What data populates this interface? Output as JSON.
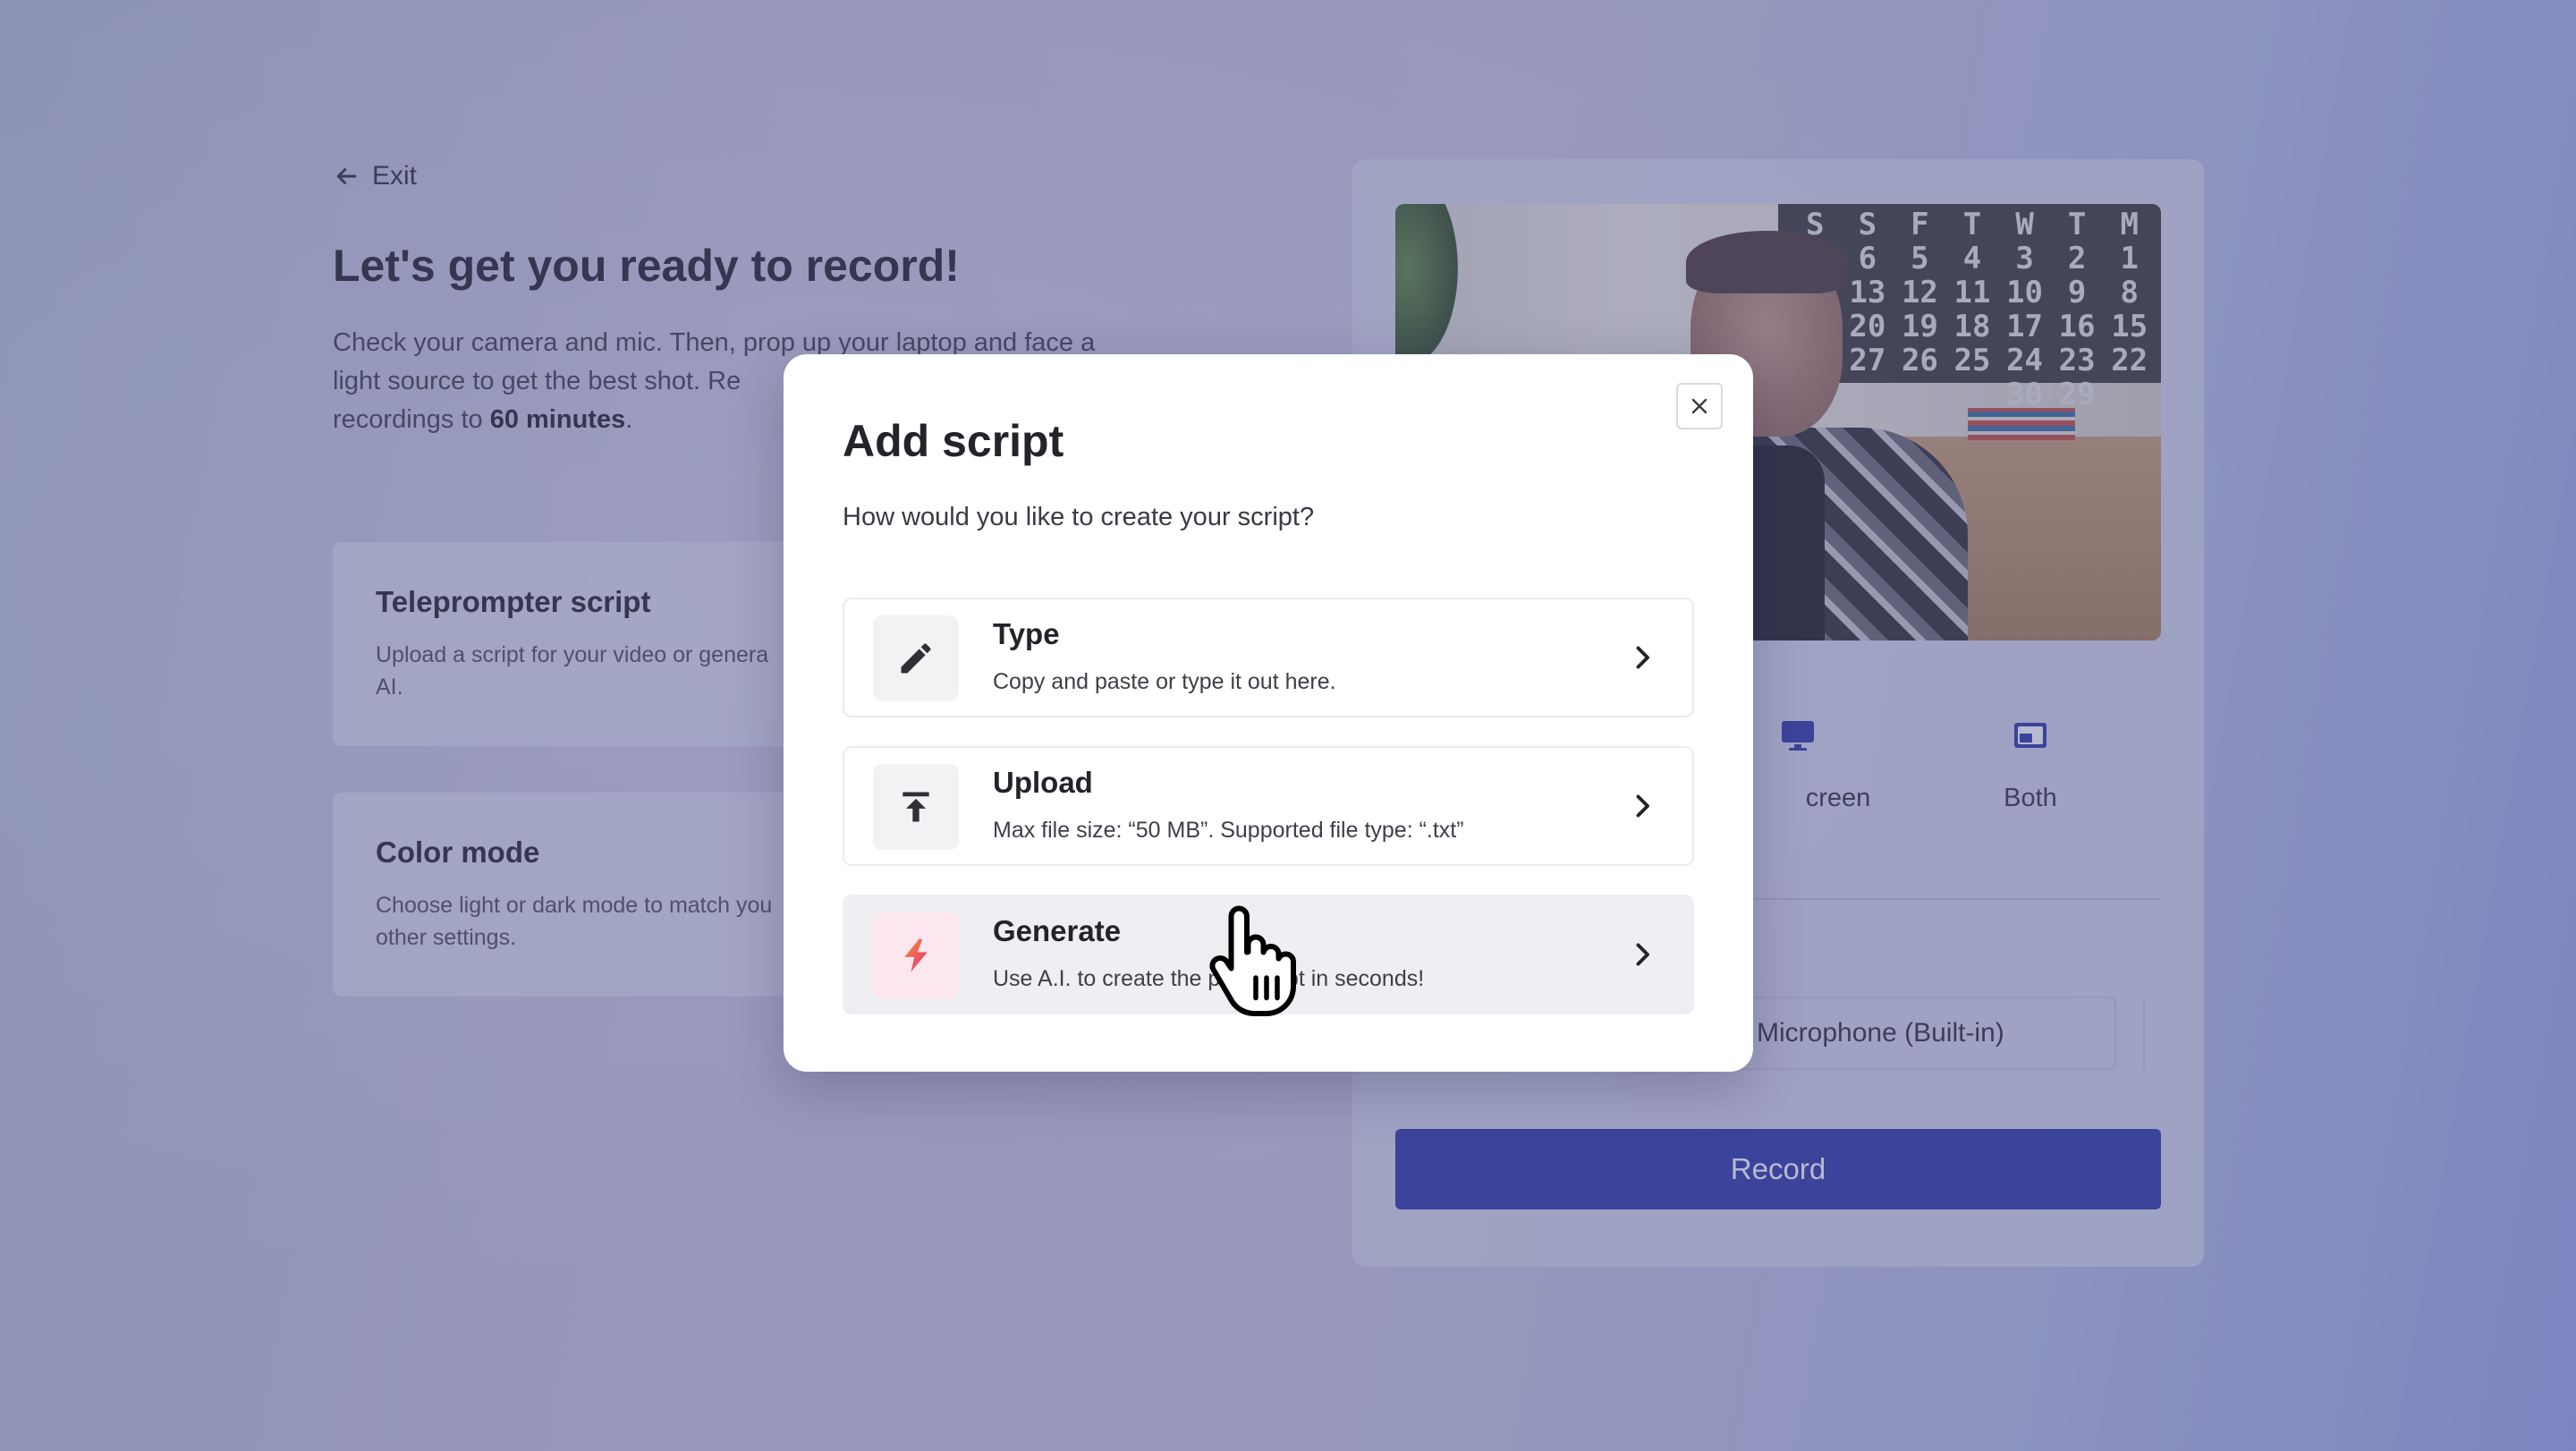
{
  "background": {
    "exit_label": "Exit",
    "title": "Let's get you ready to record!",
    "intro_part1": "Check your camera and mic. Then, prop up your laptop and face a light source to get the best shot. Re",
    "intro_part2": "recordings to ",
    "intro_bold": "60 minutes",
    "intro_end": ".",
    "cards": [
      {
        "title": "Teleprompter script",
        "description": "Upload a script for your video or genera AI."
      },
      {
        "title": "Color mode",
        "description": "Choose light or dark mode to match you other settings."
      }
    ],
    "calendar_text": [
      "S",
      "S",
      "F",
      "T",
      "W",
      "T",
      "M",
      "",
      "6",
      "5",
      "4",
      "3",
      "2",
      "1",
      "4",
      "13",
      "12",
      "11",
      "10",
      "9",
      "8",
      "1",
      "20",
      "19",
      "18",
      "17",
      "16",
      "15",
      "8",
      "27",
      "26",
      "25",
      "24",
      "23",
      "22",
      "",
      "",
      "",
      "",
      "30",
      "29",
      ""
    ],
    "record_modes": [
      {
        "label": "creen",
        "icon": "monitor-icon"
      },
      {
        "label": "Both",
        "icon": "picture-in-picture-icon"
      }
    ],
    "microphone_value": "Microphone (Built-in)",
    "record_label": "Record",
    "accent_color": "#2a34a6"
  },
  "modal": {
    "title": "Add script",
    "subtitle": "How would you like to create your script?",
    "close_icon": "close-icon",
    "options": [
      {
        "label": "Type",
        "description": "Copy and paste or type it out here.",
        "icon": "pencil-icon"
      },
      {
        "label": "Upload",
        "description": "Max file size: “50 MB”. Supported file type: “.txt”",
        "icon": "upload-icon"
      },
      {
        "label": "Generate",
        "description": "Use A.I. to create the p     script in seconds!",
        "icon": "lightning-icon",
        "state": "hovered"
      }
    ]
  }
}
